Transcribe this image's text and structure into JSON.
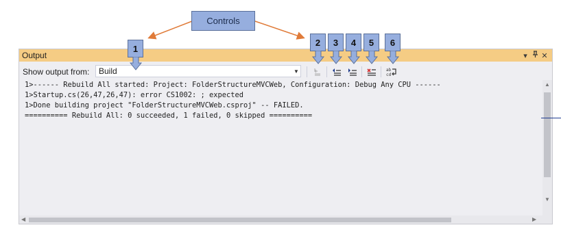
{
  "annotation": {
    "title": "Controls",
    "numbers": [
      "1",
      "2",
      "3",
      "4",
      "5",
      "6"
    ],
    "color": "#96aede",
    "arrow_color": "#e07b39"
  },
  "window": {
    "title": "Output",
    "title_bar_color": "#f5cc84",
    "buttons": {
      "dropdown": "▾",
      "pin": "ᵖ",
      "close": "✕"
    }
  },
  "toolbar": {
    "show_output_label": "Show output from:",
    "source_selected": "Build",
    "icons": [
      "go-to-line-icon",
      "previous-message-icon",
      "next-message-icon",
      "clear-all-icon",
      "toggle-word-wrap-icon"
    ]
  },
  "output": {
    "lines": [
      "1>------ Rebuild All started: Project: FolderStructureMVCWeb, Configuration: Debug Any CPU ------",
      "1>Startup.cs(26,47,26,47): error CS1002: ; expected",
      "1>Done building project \"FolderStructureMVCWeb.csproj\" -- FAILED.",
      "========== Rebuild All: 0 succeeded, 1 failed, 0 skipped =========="
    ]
  }
}
